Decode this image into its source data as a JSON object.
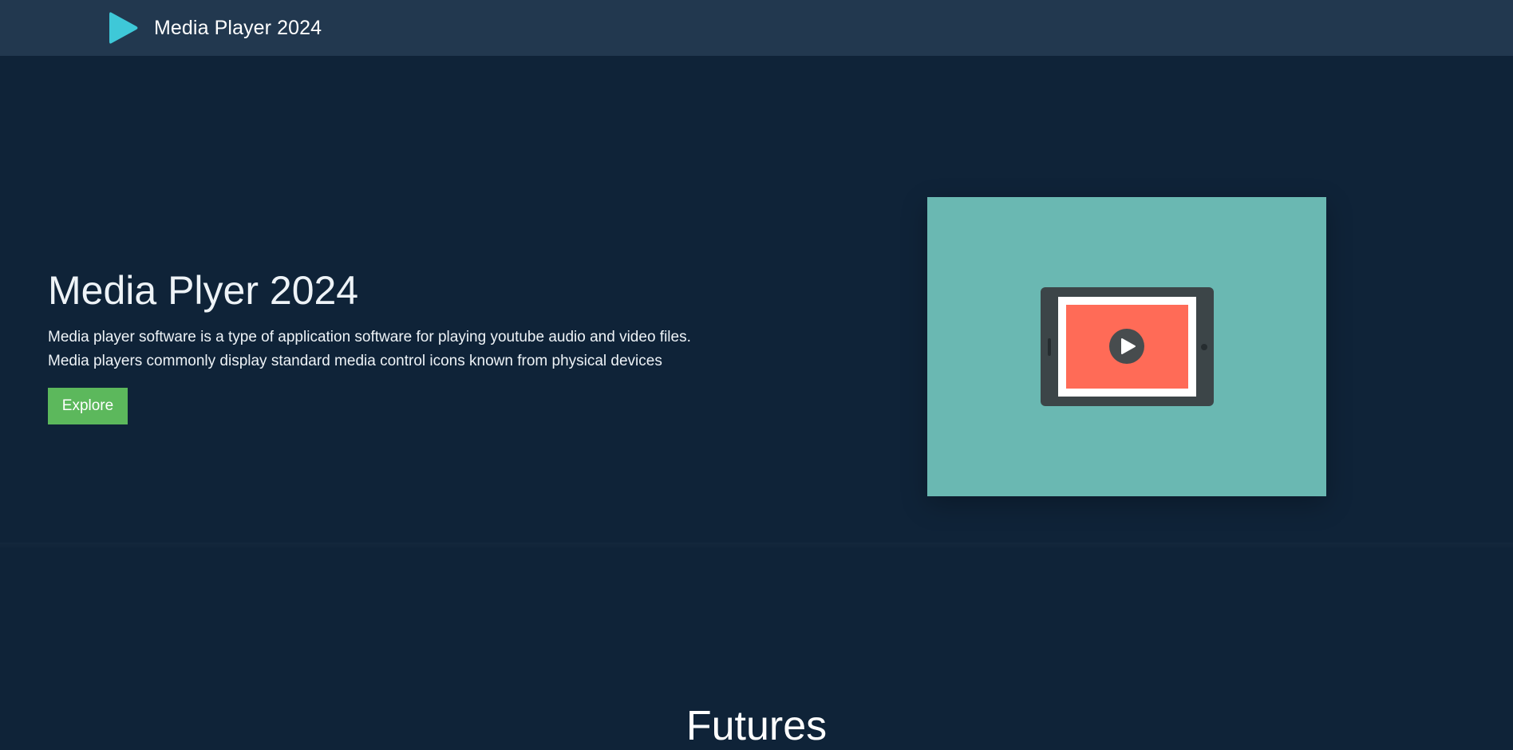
{
  "navbar": {
    "brand_name": "Media Player 2024",
    "logo_icon": "play-triangle-icon",
    "logo_color": "#3ec8d8"
  },
  "hero": {
    "title": "Media Plyer 2024",
    "description_lines": [
      "Media player software is a type of application software for playing youtube audio and video files.",
      "Media players commonly display standard media control icons known from physical devices"
    ],
    "cta_label": "Explore",
    "cta_color": "#5cb85c",
    "illustration": {
      "icon": "tablet-video-play-icon",
      "background_color": "#6ab8b2",
      "screen_color": "#ff6b57"
    }
  },
  "features": {
    "heading": "Futures"
  },
  "colors": {
    "page_background": "#0f2338",
    "navbar_background": "#22384f"
  }
}
